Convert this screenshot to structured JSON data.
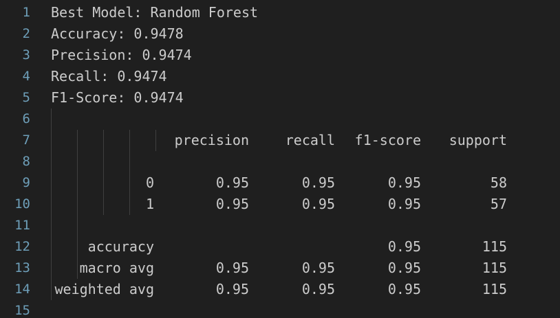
{
  "gutter": {
    "line_numbers": [
      "1",
      "2",
      "3",
      "4",
      "5",
      "6",
      "7",
      "8",
      "9",
      "10",
      "11",
      "12",
      "13",
      "14",
      "15"
    ]
  },
  "output": {
    "lines": [
      "Best Model: Random Forest",
      "Accuracy: 0.9478",
      "Precision: 0.9474",
      "Recall: 0.9474",
      "F1-Score: 0.9474"
    ],
    "report": {
      "headers": [
        "precision",
        "recall",
        "f1-score",
        "support"
      ],
      "rows": [
        {
          "label": "0",
          "precision": "0.95",
          "recall": "0.95",
          "f1": "0.95",
          "support": "58"
        },
        {
          "label": "1",
          "precision": "0.95",
          "recall": "0.95",
          "f1": "0.95",
          "support": "57"
        },
        {
          "label": "accuracy",
          "precision": "",
          "recall": "",
          "f1": "0.95",
          "support": "115"
        },
        {
          "label": "macro avg",
          "precision": "0.95",
          "recall": "0.95",
          "f1": "0.95",
          "support": "115"
        },
        {
          "label": "weighted avg",
          "precision": "0.95",
          "recall": "0.95",
          "f1": "0.95",
          "support": "115"
        }
      ]
    }
  },
  "colors": {
    "background": "#1f1f1f",
    "text": "#cccccc",
    "line_number": "#6e9fb9",
    "indent_guide": "#404040"
  }
}
